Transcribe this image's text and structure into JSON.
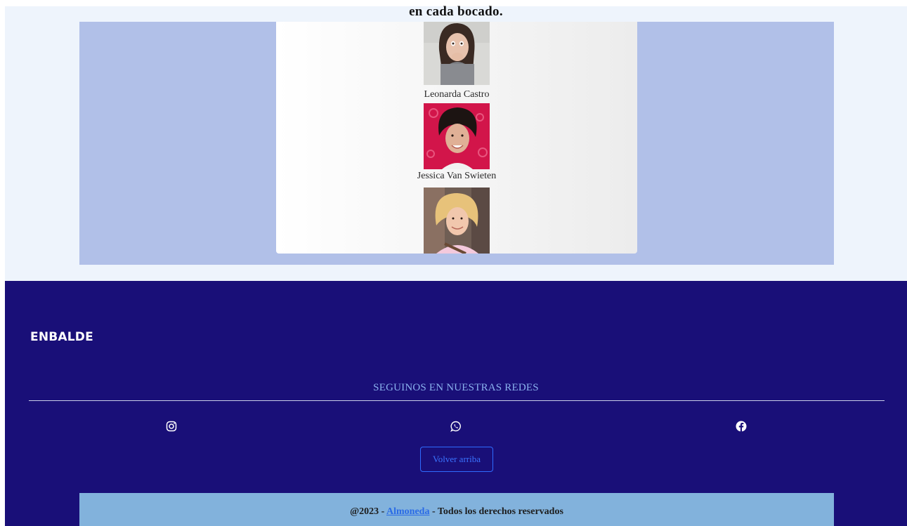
{
  "section": {
    "heading": "en cada bocado."
  },
  "testimonials": [
    {
      "name": "Leonarda Castro"
    },
    {
      "name": "Jessica Van Swieten"
    },
    {
      "name": ""
    }
  ],
  "footer": {
    "brand": "ENBALDE",
    "social_title": "SEGUINOS EN NUESTRAS REDES",
    "social_icons": [
      "instagram-icon",
      "whatsapp-icon",
      "facebook-icon"
    ],
    "back_to_top": "Volver arriba",
    "copyright": {
      "prefix": "@2023 - ",
      "link": "Almoneda",
      "suffix": " - Todos los derechos reservados"
    }
  },
  "colors": {
    "footer_bg": "#190f78",
    "band_bg": "#b1c0e8",
    "accent_link": "#3a73ff",
    "copyright_bg": "#82b2dc"
  }
}
